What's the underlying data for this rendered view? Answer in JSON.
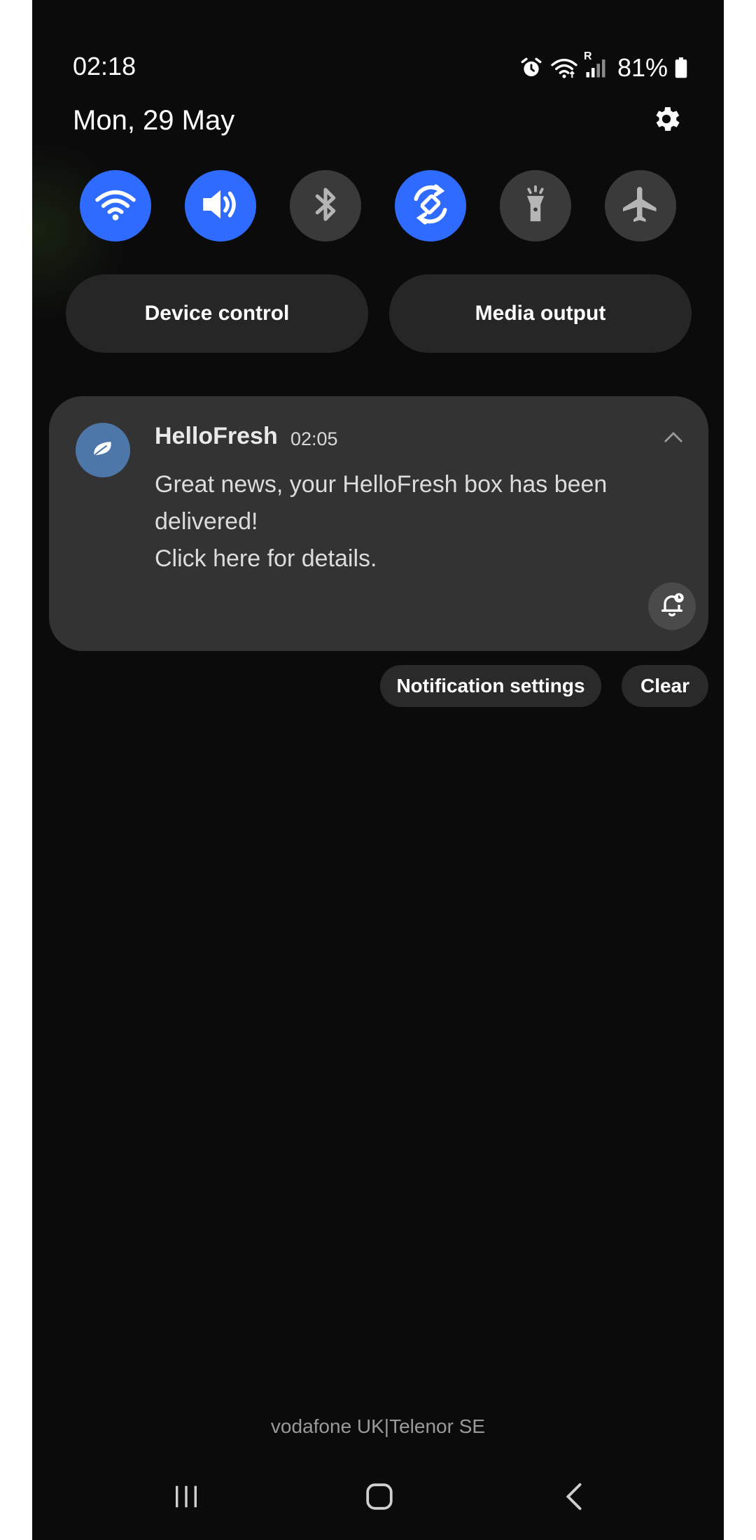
{
  "status_bar": {
    "time": "02:18",
    "roaming_indicator": "R",
    "battery_percent": "81%",
    "icons": [
      "alarm-icon",
      "wifi-icon",
      "signal-icon",
      "battery-icon"
    ]
  },
  "header": {
    "date": "Mon, 29 May",
    "settings_icon": "gear-icon"
  },
  "quick_toggles": [
    {
      "name": "wifi",
      "icon": "wifi-icon",
      "active": true
    },
    {
      "name": "sound",
      "icon": "volume-icon",
      "active": true
    },
    {
      "name": "bluetooth",
      "icon": "bluetooth-icon",
      "active": false
    },
    {
      "name": "auto-rotate",
      "icon": "rotate-icon",
      "active": true
    },
    {
      "name": "flashlight",
      "icon": "flashlight-icon",
      "active": false
    },
    {
      "name": "airplane-mode",
      "icon": "airplane-icon",
      "active": false
    }
  ],
  "panel_buttons": {
    "device_control": "Device control",
    "media_output": "Media output"
  },
  "notification": {
    "app_name": "HelloFresh",
    "time": "02:05",
    "line1": "Great news, your HelloFresh box has been",
    "line2": "delivered!",
    "line3": "Click here for details.",
    "app_icon": "hellofresh-leaf-icon",
    "collapse_icon": "chevron-up-icon",
    "snooze_icon": "bell-snooze-icon"
  },
  "notification_actions": {
    "settings": "Notification settings",
    "clear": "Clear"
  },
  "carrier": "vodafone UK|Telenor SE",
  "nav_bar": {
    "recents": "recents-icon",
    "home": "home-icon",
    "back": "back-icon"
  },
  "colors": {
    "accent": "#2f6bff",
    "background": "#0b0b0b",
    "card": "#333333",
    "app_icon_bg": "#4e77a9"
  }
}
